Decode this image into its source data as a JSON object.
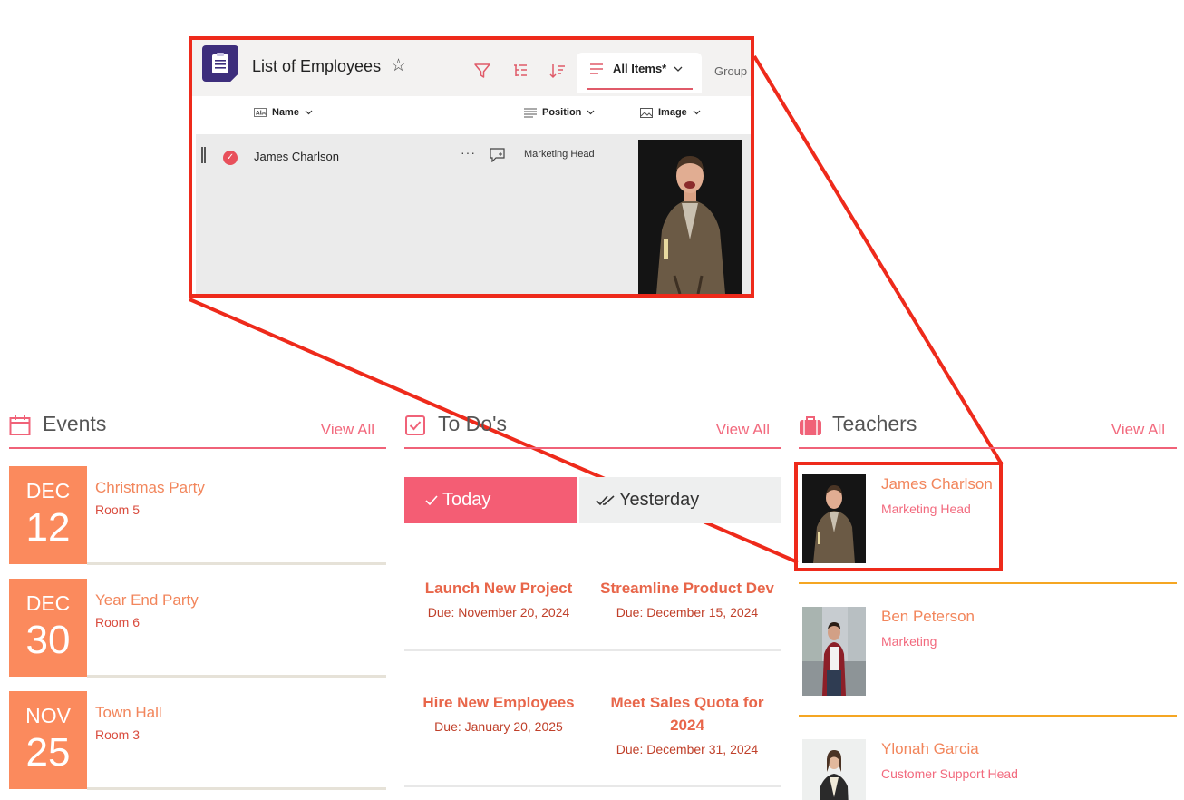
{
  "sharepoint": {
    "title": "List of Employees",
    "view_label": "All Items*",
    "group_label": "Group",
    "columns": {
      "name": "Name",
      "position": "Position",
      "image": "Image"
    },
    "row": {
      "name": "James Charlson",
      "position": "Marketing Head"
    }
  },
  "events": {
    "title": "Events",
    "view_all": "View All",
    "items": [
      {
        "month": "DEC",
        "day": "12",
        "title": "Christmas Party",
        "room": "Room 5"
      },
      {
        "month": "DEC",
        "day": "30",
        "title": "Year End Party",
        "room": "Room 6"
      },
      {
        "month": "NOV",
        "day": "25",
        "title": "Town Hall",
        "room": "Room 3"
      }
    ]
  },
  "todos": {
    "title": "To Do's",
    "view_all": "View All",
    "tabs": {
      "today": "Today",
      "yesterday": "Yesterday"
    },
    "items": [
      {
        "title": "Launch New Project",
        "due": "Due: November 20, 2024"
      },
      {
        "title": "Streamline Product Dev",
        "due": "Due: December 15, 2024"
      },
      {
        "title": "Hire New Employees",
        "due": "Due: January 20, 2025"
      },
      {
        "title": "Meet Sales Quota for 2024",
        "due": "Due: December 31, 2024"
      }
    ]
  },
  "teachers": {
    "title": "Teachers",
    "view_all": "View All",
    "items": [
      {
        "name": "James Charlson",
        "position": "Marketing Head"
      },
      {
        "name": "Ben Peterson",
        "position": "Marketing"
      },
      {
        "name": "Ylonah Garcia",
        "position": "Customer Support Head"
      }
    ]
  },
  "colors": {
    "accent": "#f45d74",
    "event_date_bg": "#fb8a5d",
    "callout_red": "#ee2a1b",
    "teacher_divider": "#f5a623"
  }
}
